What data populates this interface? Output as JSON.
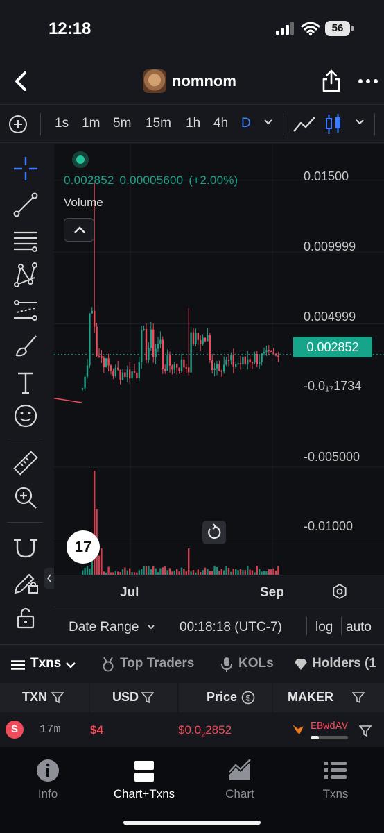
{
  "status_bar": {
    "time": "12:18",
    "battery": "56"
  },
  "header": {
    "title": "nomnom"
  },
  "timeframes": {
    "items": [
      {
        "label": "1s",
        "active": false
      },
      {
        "label": "1m",
        "active": false
      },
      {
        "label": "5m",
        "active": false
      },
      {
        "label": "15m",
        "active": false
      },
      {
        "label": "1h",
        "active": false
      },
      {
        "label": "4h",
        "active": false
      },
      {
        "label": "D",
        "active": true
      }
    ]
  },
  "chart": {
    "ohlc_price": "0.002852",
    "ohlc_change": "0.00005600",
    "ohlc_change_pct": "(+2.00%)",
    "volume_label": "Volume",
    "price_scale": [
      "0.01500",
      "0.009999",
      "0.004999",
      "-0.0₁₇1734",
      "-0.005000",
      "-0.01000"
    ],
    "current_price": "0.002852",
    "time_labels": [
      "Jul",
      "Sep"
    ],
    "logo_text": "17"
  },
  "chart_data": {
    "type": "candlestick",
    "title": "",
    "xlabel": "",
    "ylabel": "",
    "x_ticks": [
      "Jul",
      "Sep"
    ],
    "y_ticks": [
      0.015,
      0.009999,
      0.004999,
      -0.005,
      -0.01
    ],
    "ylim": [
      -0.0125,
      0.0175
    ],
    "last_price": 0.002852,
    "spikes": [
      {
        "x": "early Jul",
        "high": 0.0148
      },
      {
        "x": "mid Jul",
        "high": 0.0061
      }
    ],
    "grid": true
  },
  "range_bar": {
    "date_range": "Date Range",
    "time": "00:18:18 (UTC-7)",
    "log": "log",
    "auto": "auto"
  },
  "tabs": [
    {
      "label": "Txns",
      "active": true
    },
    {
      "label": "Top Traders",
      "active": false
    },
    {
      "label": "KOLs",
      "active": false
    },
    {
      "label": "Holders (1",
      "active": false
    }
  ],
  "table": {
    "headers": {
      "txn": "TXN",
      "usd": "USD",
      "price": "Price",
      "maker": "MAKER"
    },
    "rows": [
      {
        "type": "S",
        "age": "17m",
        "usd": "$4",
        "price_prefix": "$0.0",
        "price_sub": "2",
        "price_rest": "2852",
        "maker": "EBwdAV"
      }
    ]
  },
  "bottom_nav": [
    {
      "label": "Info",
      "active": false
    },
    {
      "label": "Chart+Txns",
      "active": true
    },
    {
      "label": "Chart",
      "active": false
    },
    {
      "label": "Txns",
      "active": false
    }
  ],
  "colors": {
    "accent": "#3a7bff",
    "up": "#1fa28a",
    "down": "#f04a5b",
    "badge": "#16a58a"
  }
}
